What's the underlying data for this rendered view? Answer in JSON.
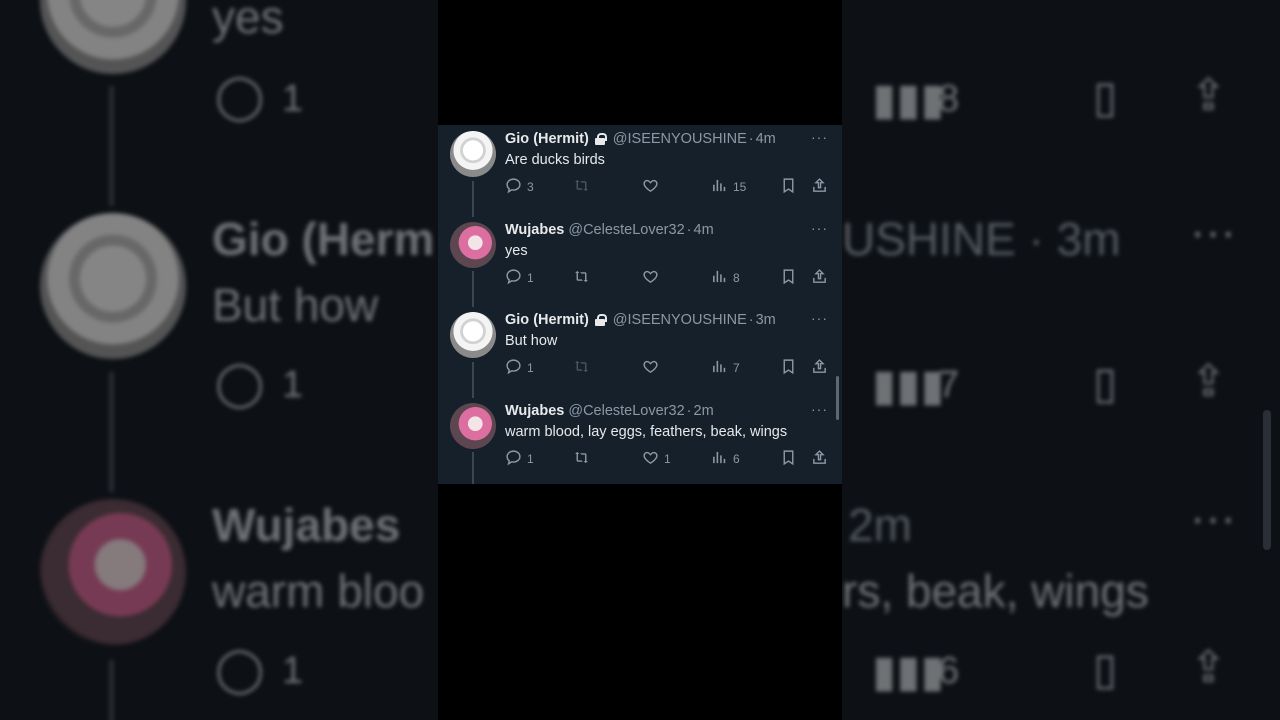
{
  "background_preview": {
    "top_text": "yes",
    "top_reply_count": "1",
    "top_views": "8",
    "name_partial": "Gio (Herm",
    "handle_partial": "USHINE · 3m",
    "body_text": "But how",
    "mid_reply_count": "1",
    "mid_views": "7",
    "name2_partial": "Wujabes",
    "time2_partial": "2m",
    "body2_left": "warm bloo",
    "body2_right": "rs, beak, wings",
    "bottom_reply_count": "1",
    "bottom_views": "6"
  },
  "tweets": [
    {
      "name": "Gio (Hermit)",
      "locked": true,
      "handle": "@ISEENYOUSHINE",
      "time": "4m",
      "text": "Are ducks birds",
      "replies": "3",
      "reposts": "",
      "likes": "",
      "views": "15",
      "repost_disabled": true
    },
    {
      "name": "Wujabes",
      "locked": false,
      "handle": "@CelesteLover32",
      "time": "4m",
      "text": "yes",
      "replies": "1",
      "reposts": "",
      "likes": "",
      "views": "8",
      "repost_disabled": false
    },
    {
      "name": "Gio (Hermit)",
      "locked": true,
      "handle": "@ISEENYOUSHINE",
      "time": "3m",
      "text": "But how",
      "replies": "1",
      "reposts": "",
      "likes": "",
      "views": "7",
      "repost_disabled": true
    },
    {
      "name": "Wujabes",
      "locked": false,
      "handle": "@CelesteLover32",
      "time": "2m",
      "text": "warm blood, lay eggs, feathers, beak, wings",
      "replies": "1",
      "reposts": "",
      "likes": "1",
      "views": "6",
      "repost_disabled": false
    }
  ],
  "separator": "·",
  "more_glyph": "···"
}
